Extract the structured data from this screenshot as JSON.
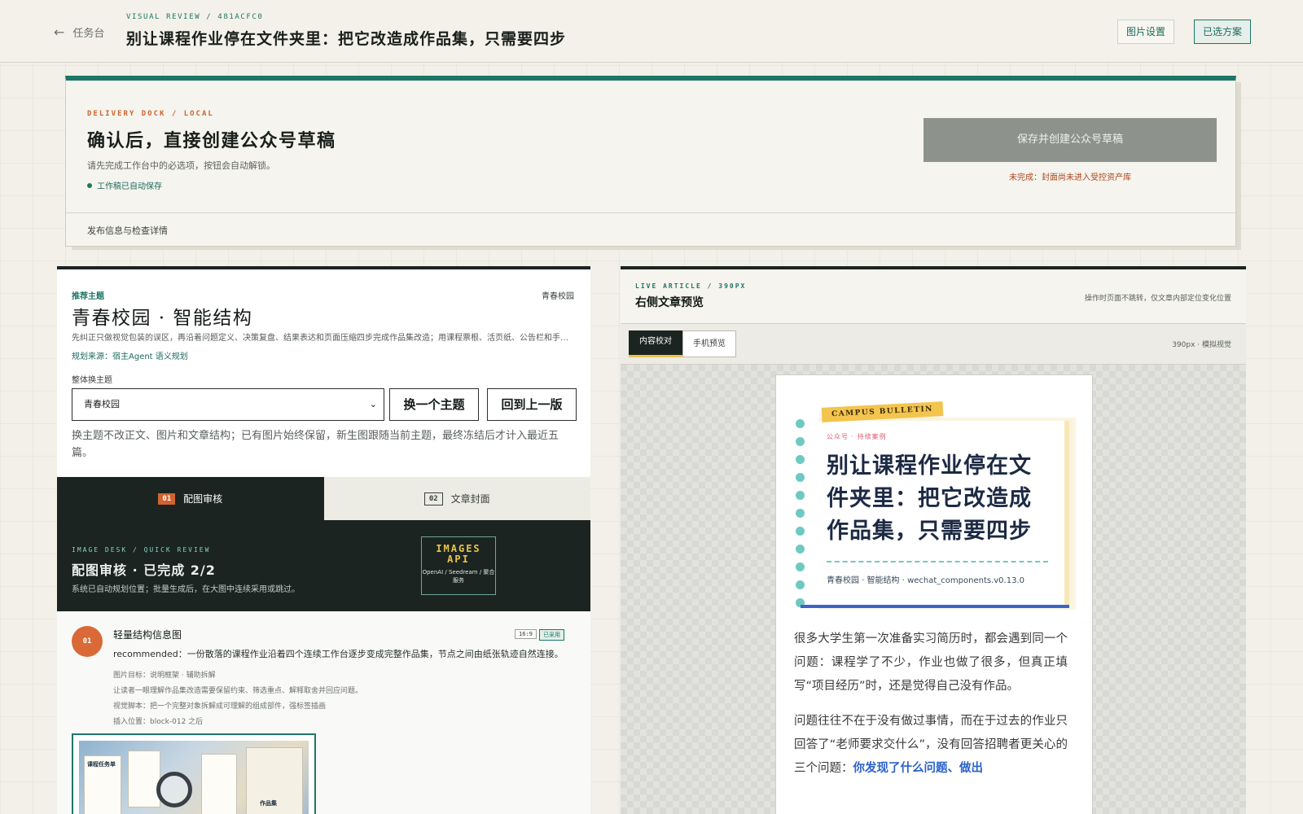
{
  "header": {
    "back_label": "任务台",
    "kicker": "VISUAL REVIEW / 481ACFC0",
    "title": "别让课程作业停在文件夹里：把它改造成作品集，只需要四步",
    "image_settings_label": "图片设置",
    "selected_plan_label": "已选方案"
  },
  "dock": {
    "eyebrow": "DELIVERY DOCK / LOCAL",
    "heading": "确认后，直接创建公众号草稿",
    "sub": "请先完成工作台中的必选项，按钮会自动解锁。",
    "autosave": "工作稿已自动保存",
    "save_button": "保存并创建公众号草稿",
    "warning": "未完成：封面尚未进入受控资产库",
    "details_link": "发布信息与检查详情"
  },
  "theme": {
    "label": "推荐主题",
    "corner": "青春校园",
    "title": "青春校园 · 智能结构",
    "description": "先纠正只做视觉包装的误区，再沿着问题定义、决策复盘、结果表达和页面压缩四步完成作品集改造；用课程票根、活页纸、公告栏和手…",
    "source": "规划来源：宿主Agent 语义规划",
    "switch_label": "整体换主题",
    "select_value": "青春校园",
    "swap_button": "换一个主题",
    "revert_button": "回到上一版",
    "note": "换主题不改正文、图片和文章结构；已有图片始终保留，新生图跟随当前主题，最终冻结后才计入最近五篇。"
  },
  "tabs": [
    {
      "num": "01",
      "label": "配图审核"
    },
    {
      "num": "02",
      "label": "文章封面"
    }
  ],
  "image_desk": {
    "eyebrow": "IMAGE DESK / QUICK REVIEW",
    "title": "配图审核 · 已完成 2/2",
    "hint": "系统已自动规划位置；批量生成后，在大图中连续采用或跳过。",
    "api_big": "IMAGES API",
    "api_small": "OpenAI / Seedream / 聚合服务"
  },
  "image_card": {
    "index": "01",
    "title": "轻量结构信息图",
    "ratio": "16:9",
    "status": "已采用",
    "recommended": "recommended：一份散落的课程作业沿着四个连续工作台逐步变成完整作品集，节点之间由纸张轨迹自然连接。",
    "goal": "图片目标：说明框架 · 辅助拆解",
    "reader": "让读者一眼理解作品集改造需要保留约束、筛选重点、解释取舍并回应问题。",
    "script": "视觉脚本：把一个完整对象拆解成可理解的组成部件，强标签插画",
    "insert": "插入位置：block-012 之后",
    "thumb_labels": [
      "课程任务单",
      "作品集"
    ]
  },
  "preview": {
    "eyebrow": "LIVE ARTICLE / 390PX",
    "title": "右侧文章预览",
    "note": "操作时页面不跳转，仅文章内部定位变化位置",
    "seg_content": "内容校对",
    "seg_phone": "手机预览",
    "width_note": "390px · 模拟视觉",
    "tag": "CAMPUS BULLETIN",
    "channel": "公众号 · 持续案例",
    "headline": "别让课程作业停在文件夹里：把它改造成作品集，只需要四步",
    "meta": "青春校园 · 智能结构 · wechat_components.v0.13.0",
    "para1": "很多大学生第一次准备实习简历时，都会遇到同一个问题：课程学了不少，作业也做了很多，但真正填写“项目经历”时，还是觉得自己没有作品。",
    "para2_pre": "问题往往不在于没有做过事情，而在于过去的作业只回答了“老师要求交什么”，没有回答招聘者更关心的三个问题：",
    "para2_hl": "你发现了什么问题、做出"
  },
  "colors": {
    "accent": "#1e7667",
    "orange": "#d96a37",
    "dark": "#1b2421",
    "yellow": "#f3c44e",
    "teal_dot": "#6ec9c2",
    "link_blue": "#2b62c9"
  }
}
